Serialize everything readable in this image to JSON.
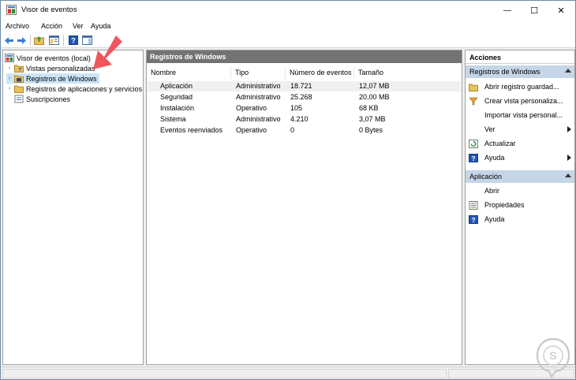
{
  "window": {
    "title": "Visor de eventos",
    "controls": {
      "minimize": "—",
      "maximize": "☐",
      "close": "✕"
    }
  },
  "menu": [
    "Archivo",
    "Acción",
    "Ver",
    "Ayuda"
  ],
  "toolbar_icons": [
    "back-arrow-icon",
    "forward-arrow-icon",
    "up-folder-icon",
    "show-hide-tree-icon",
    "help-icon",
    "show-action-pane-icon"
  ],
  "tree": {
    "root": "Visor de eventos (local)",
    "items": [
      {
        "label": "Vistas personalizadas",
        "expander": "›",
        "icon": "folder-filter-icon"
      },
      {
        "label": "Registros de Windows",
        "expander": "›",
        "icon": "event-log-folder-icon",
        "selected": true
      },
      {
        "label": "Registros de aplicaciones y servicios",
        "expander": "›",
        "icon": "folder-icon"
      },
      {
        "label": "Suscripciones",
        "expander": "",
        "icon": "subscriptions-icon"
      }
    ]
  },
  "main": {
    "header": "Registros de Windows",
    "columns": [
      "Nombre",
      "Tipo",
      "Número de eventos",
      "Tamaño"
    ],
    "rows": [
      [
        "Aplicación",
        "Administrativo",
        "18.721",
        "12,07 MB"
      ],
      [
        "Seguridad",
        "Administrativo",
        "25.268",
        "20,00 MB"
      ],
      [
        "Instalación",
        "Operativo",
        "105",
        "68 KB"
      ],
      [
        "Sistema",
        "Administrativo",
        "4.210",
        "3,07 MB"
      ],
      [
        "Eventos reenviados",
        "Operativo",
        "0",
        "0 Bytes"
      ]
    ]
  },
  "actions": {
    "title": "Acciones",
    "sections": [
      {
        "title": "Registros de Windows",
        "items": [
          {
            "label": "Abrir registro guardad...",
            "icon": "open-folder-icon"
          },
          {
            "label": "Crear vista personaliza...",
            "icon": "filter-icon"
          },
          {
            "label": "Importar vista personal...",
            "icon": ""
          },
          {
            "label": "Ver",
            "icon": "",
            "submenu": true
          },
          {
            "label": "Actualizar",
            "icon": "refresh-icon"
          },
          {
            "label": "Ayuda",
            "icon": "help-icon",
            "submenu": true
          }
        ]
      },
      {
        "title": "Aplicación",
        "items": [
          {
            "label": "Abrir",
            "icon": ""
          },
          {
            "label": "Propiedades",
            "icon": "properties-icon"
          },
          {
            "label": "Ayuda",
            "icon": "help-icon"
          }
        ]
      }
    ]
  },
  "colors": {
    "accent_arrow": "#f0565e",
    "selection": "#cce4f7",
    "section_bar": "#c5d6e8",
    "header_bar": "#737373",
    "help_blue": "#1f56b6"
  }
}
